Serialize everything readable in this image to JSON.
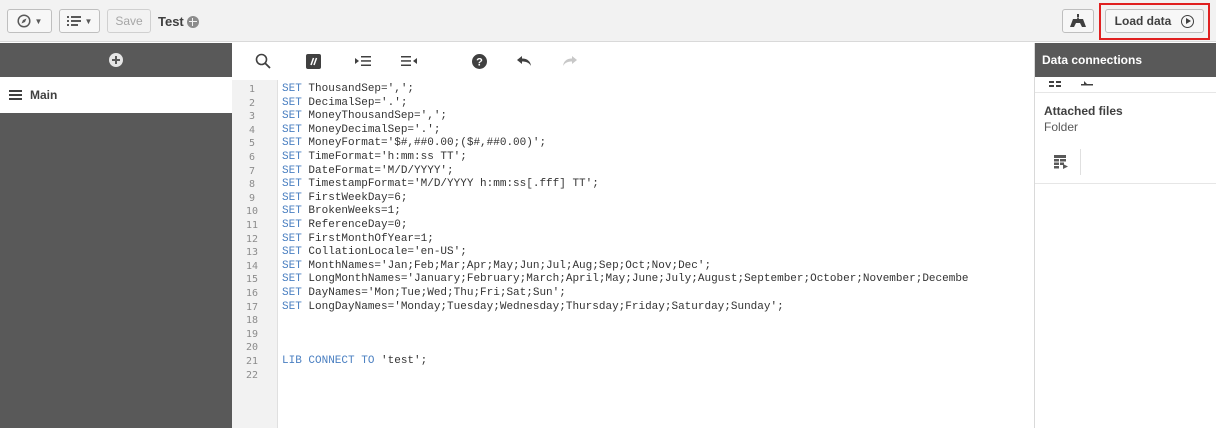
{
  "toolbar": {
    "navigation_icon": "compass-icon",
    "menu_icon": "list-icon",
    "save_label": "Save",
    "app_title": "Test",
    "debug_icon": "debug-icon",
    "load_label": "Load data"
  },
  "editor_toolbar": {
    "icons": [
      "search-icon",
      "comment-icon",
      "indent-icon",
      "outdent-icon",
      "help-icon",
      "undo-icon",
      "redo-icon"
    ]
  },
  "left_panel": {
    "add_icon": "plus-icon",
    "section_label": "Main"
  },
  "editor": {
    "line_numbers": [
      "1",
      "2",
      "3",
      "4",
      "5",
      "6",
      "7",
      "8",
      "9",
      "10",
      "11",
      "12",
      "13",
      "14",
      "15",
      "16",
      "17",
      "18",
      "19",
      "20",
      "21",
      "22"
    ],
    "lines": [
      {
        "kw": "SET",
        "text": " ThousandSep=',';"
      },
      {
        "kw": "SET",
        "text": " DecimalSep='.';"
      },
      {
        "kw": "SET",
        "text": " MoneyThousandSep=',';"
      },
      {
        "kw": "SET",
        "text": " MoneyDecimalSep='.';"
      },
      {
        "kw": "SET",
        "text": " MoneyFormat='$#,##0.00;($#,##0.00)';"
      },
      {
        "kw": "SET",
        "text": " TimeFormat='h:mm:ss TT';"
      },
      {
        "kw": "SET",
        "text": " DateFormat='M/D/YYYY';"
      },
      {
        "kw": "SET",
        "text": " TimestampFormat='M/D/YYYY h:mm:ss[.fff] TT';"
      },
      {
        "kw": "SET",
        "text": " FirstWeekDay=6;"
      },
      {
        "kw": "SET",
        "text": " BrokenWeeks=1;"
      },
      {
        "kw": "SET",
        "text": " ReferenceDay=0;"
      },
      {
        "kw": "SET",
        "text": " FirstMonthOfYear=1;"
      },
      {
        "kw": "SET",
        "text": " CollationLocale='en-US';"
      },
      {
        "kw": "SET",
        "text": " MonthNames='Jan;Feb;Mar;Apr;May;Jun;Jul;Aug;Sep;Oct;Nov;Dec';"
      },
      {
        "kw": "SET",
        "text": " LongMonthNames='January;February;March;April;May;June;July;August;September;October;November;Decembe"
      },
      {
        "kw": "SET",
        "text": " DayNames='Mon;Tue;Wed;Thu;Fri;Sat;Sun';"
      },
      {
        "kw": "SET",
        "text": " LongDayNames='Monday;Tuesday;Wednesday;Thursday;Friday;Saturday;Sunday';"
      },
      {
        "kw": "",
        "text": ""
      },
      {
        "kw": "",
        "text": ""
      },
      {
        "kw": "",
        "text": ""
      },
      {
        "kw": "LIB CONNECT TO",
        "text": " 'test';"
      },
      {
        "kw": "",
        "text": ""
      }
    ]
  },
  "right_panel": {
    "title": "Data connections",
    "attached_label": "Attached files",
    "folder_label": "Folder",
    "table_icon": "table-icon"
  }
}
